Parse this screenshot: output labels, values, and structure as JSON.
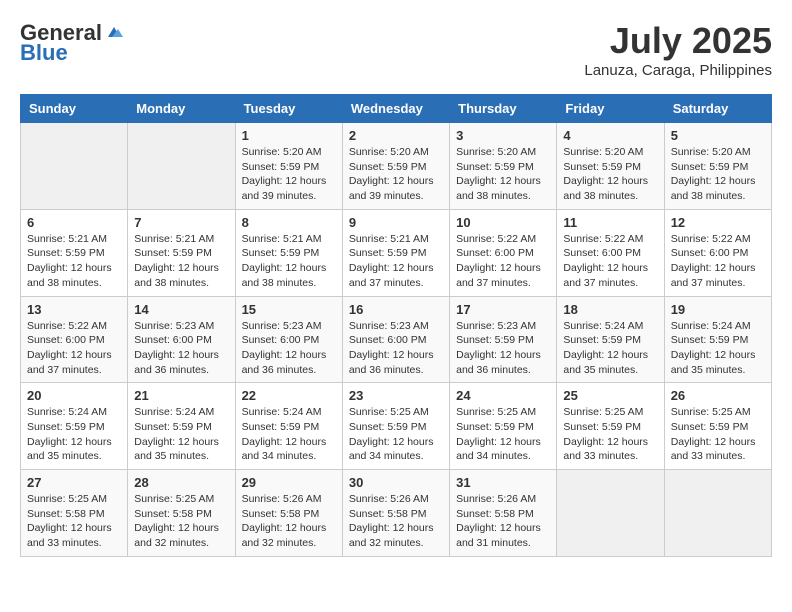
{
  "logo": {
    "general": "General",
    "blue": "Blue"
  },
  "title": {
    "month_year": "July 2025",
    "location": "Lanuza, Caraga, Philippines"
  },
  "weekdays": [
    "Sunday",
    "Monday",
    "Tuesday",
    "Wednesday",
    "Thursday",
    "Friday",
    "Saturday"
  ],
  "weeks": [
    [
      {
        "day": "",
        "info": ""
      },
      {
        "day": "",
        "info": ""
      },
      {
        "day": "1",
        "info": "Sunrise: 5:20 AM\nSunset: 5:59 PM\nDaylight: 12 hours\nand 39 minutes."
      },
      {
        "day": "2",
        "info": "Sunrise: 5:20 AM\nSunset: 5:59 PM\nDaylight: 12 hours\nand 39 minutes."
      },
      {
        "day": "3",
        "info": "Sunrise: 5:20 AM\nSunset: 5:59 PM\nDaylight: 12 hours\nand 38 minutes."
      },
      {
        "day": "4",
        "info": "Sunrise: 5:20 AM\nSunset: 5:59 PM\nDaylight: 12 hours\nand 38 minutes."
      },
      {
        "day": "5",
        "info": "Sunrise: 5:20 AM\nSunset: 5:59 PM\nDaylight: 12 hours\nand 38 minutes."
      }
    ],
    [
      {
        "day": "6",
        "info": "Sunrise: 5:21 AM\nSunset: 5:59 PM\nDaylight: 12 hours\nand 38 minutes."
      },
      {
        "day": "7",
        "info": "Sunrise: 5:21 AM\nSunset: 5:59 PM\nDaylight: 12 hours\nand 38 minutes."
      },
      {
        "day": "8",
        "info": "Sunrise: 5:21 AM\nSunset: 5:59 PM\nDaylight: 12 hours\nand 38 minutes."
      },
      {
        "day": "9",
        "info": "Sunrise: 5:21 AM\nSunset: 5:59 PM\nDaylight: 12 hours\nand 37 minutes."
      },
      {
        "day": "10",
        "info": "Sunrise: 5:22 AM\nSunset: 6:00 PM\nDaylight: 12 hours\nand 37 minutes."
      },
      {
        "day": "11",
        "info": "Sunrise: 5:22 AM\nSunset: 6:00 PM\nDaylight: 12 hours\nand 37 minutes."
      },
      {
        "day": "12",
        "info": "Sunrise: 5:22 AM\nSunset: 6:00 PM\nDaylight: 12 hours\nand 37 minutes."
      }
    ],
    [
      {
        "day": "13",
        "info": "Sunrise: 5:22 AM\nSunset: 6:00 PM\nDaylight: 12 hours\nand 37 minutes."
      },
      {
        "day": "14",
        "info": "Sunrise: 5:23 AM\nSunset: 6:00 PM\nDaylight: 12 hours\nand 36 minutes."
      },
      {
        "day": "15",
        "info": "Sunrise: 5:23 AM\nSunset: 6:00 PM\nDaylight: 12 hours\nand 36 minutes."
      },
      {
        "day": "16",
        "info": "Sunrise: 5:23 AM\nSunset: 6:00 PM\nDaylight: 12 hours\nand 36 minutes."
      },
      {
        "day": "17",
        "info": "Sunrise: 5:23 AM\nSunset: 5:59 PM\nDaylight: 12 hours\nand 36 minutes."
      },
      {
        "day": "18",
        "info": "Sunrise: 5:24 AM\nSunset: 5:59 PM\nDaylight: 12 hours\nand 35 minutes."
      },
      {
        "day": "19",
        "info": "Sunrise: 5:24 AM\nSunset: 5:59 PM\nDaylight: 12 hours\nand 35 minutes."
      }
    ],
    [
      {
        "day": "20",
        "info": "Sunrise: 5:24 AM\nSunset: 5:59 PM\nDaylight: 12 hours\nand 35 minutes."
      },
      {
        "day": "21",
        "info": "Sunrise: 5:24 AM\nSunset: 5:59 PM\nDaylight: 12 hours\nand 35 minutes."
      },
      {
        "day": "22",
        "info": "Sunrise: 5:24 AM\nSunset: 5:59 PM\nDaylight: 12 hours\nand 34 minutes."
      },
      {
        "day": "23",
        "info": "Sunrise: 5:25 AM\nSunset: 5:59 PM\nDaylight: 12 hours\nand 34 minutes."
      },
      {
        "day": "24",
        "info": "Sunrise: 5:25 AM\nSunset: 5:59 PM\nDaylight: 12 hours\nand 34 minutes."
      },
      {
        "day": "25",
        "info": "Sunrise: 5:25 AM\nSunset: 5:59 PM\nDaylight: 12 hours\nand 33 minutes."
      },
      {
        "day": "26",
        "info": "Sunrise: 5:25 AM\nSunset: 5:59 PM\nDaylight: 12 hours\nand 33 minutes."
      }
    ],
    [
      {
        "day": "27",
        "info": "Sunrise: 5:25 AM\nSunset: 5:58 PM\nDaylight: 12 hours\nand 33 minutes."
      },
      {
        "day": "28",
        "info": "Sunrise: 5:25 AM\nSunset: 5:58 PM\nDaylight: 12 hours\nand 32 minutes."
      },
      {
        "day": "29",
        "info": "Sunrise: 5:26 AM\nSunset: 5:58 PM\nDaylight: 12 hours\nand 32 minutes."
      },
      {
        "day": "30",
        "info": "Sunrise: 5:26 AM\nSunset: 5:58 PM\nDaylight: 12 hours\nand 32 minutes."
      },
      {
        "day": "31",
        "info": "Sunrise: 5:26 AM\nSunset: 5:58 PM\nDaylight: 12 hours\nand 31 minutes."
      },
      {
        "day": "",
        "info": ""
      },
      {
        "day": "",
        "info": ""
      }
    ]
  ]
}
